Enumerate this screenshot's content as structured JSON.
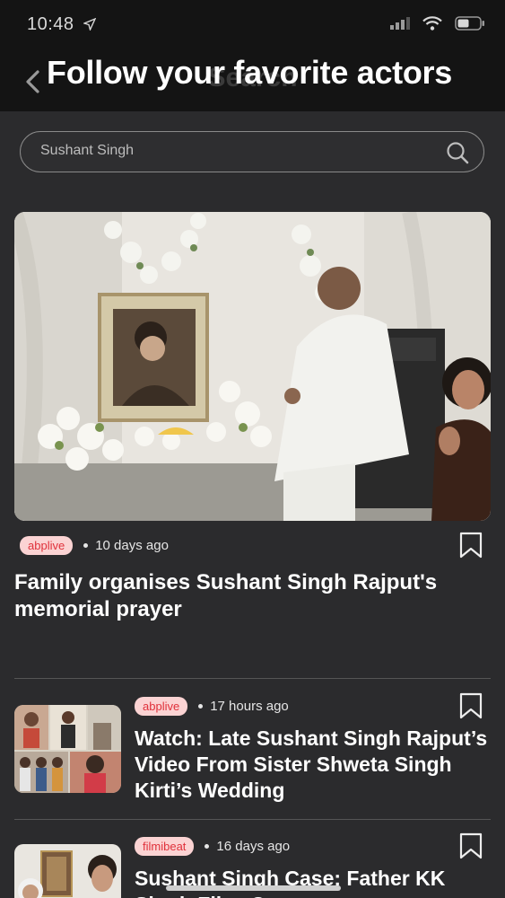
{
  "status": {
    "time": "10:48"
  },
  "header": {
    "title": "Search",
    "overlay_text": "Follow your favorite actors"
  },
  "search": {
    "value": "Sushant Singh"
  },
  "articles": [
    {
      "source": "abplive",
      "time": "10 days ago",
      "title": "Family organises Sushant Singh Rajput's memorial prayer"
    },
    {
      "source": "abplive",
      "time": "17 hours ago",
      "title": "Watch: Late Sushant Singh Rajput’s Video From Sister Shweta Singh Kirti’s Wedding"
    },
    {
      "source": "filmibeat",
      "time": "16 days ago",
      "title": "Sushant Singh Case: Father KK Singh Files Case"
    }
  ],
  "colors": {
    "background": "#2b2b2d",
    "bar": "#141414",
    "badge_bg": "#fbd3d3",
    "badge_text": "#e0313b"
  },
  "icons": [
    "location-arrow-icon",
    "signal-icon",
    "wifi-icon",
    "battery-icon",
    "back-chevron-icon",
    "search-icon",
    "bookmark-icon"
  ]
}
